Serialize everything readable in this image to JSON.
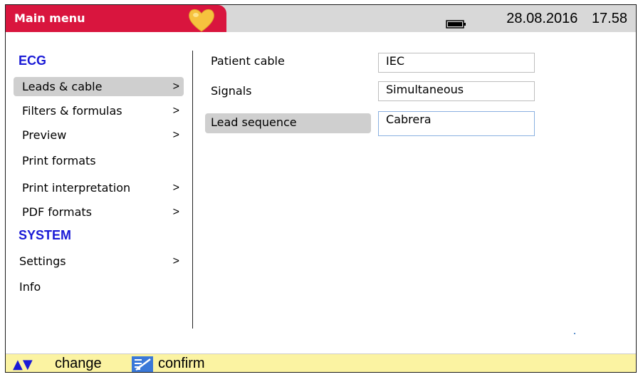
{
  "header": {
    "title": "Main menu",
    "date": "28.08.2016",
    "time": "17.58",
    "colors": {
      "title_bg": "#d9153e",
      "header_bg": "#d8d8d8"
    },
    "icons": [
      "heart-icon",
      "battery-icon"
    ]
  },
  "sidebar": {
    "sections": [
      {
        "title": "ECG",
        "items": [
          {
            "label": "Leads & cable",
            "arrow": ">",
            "selected": true
          },
          {
            "label": "Filters & formulas",
            "arrow": ">"
          },
          {
            "label": "Preview",
            "arrow": ">"
          },
          {
            "label": "Print formats"
          },
          {
            "label": "Print interpretation",
            "arrow": ">"
          },
          {
            "label": "PDF formats",
            "arrow": ">"
          }
        ]
      },
      {
        "title": "SYSTEM",
        "items": [
          {
            "label": "Settings",
            "arrow": ">"
          },
          {
            "label": "Info"
          }
        ]
      }
    ]
  },
  "fields": [
    {
      "label": "Patient cable",
      "value": "IEC"
    },
    {
      "label": "Signals",
      "value": "Simultaneous"
    },
    {
      "label": "Lead sequence",
      "value": "Cabrera",
      "selected": true
    }
  ],
  "footer": {
    "change_label": "change",
    "confirm_label": "confirm",
    "bg_color": "#fbf3a2",
    "icons": [
      "up-down-arrows-icon",
      "confirm-icon"
    ]
  }
}
